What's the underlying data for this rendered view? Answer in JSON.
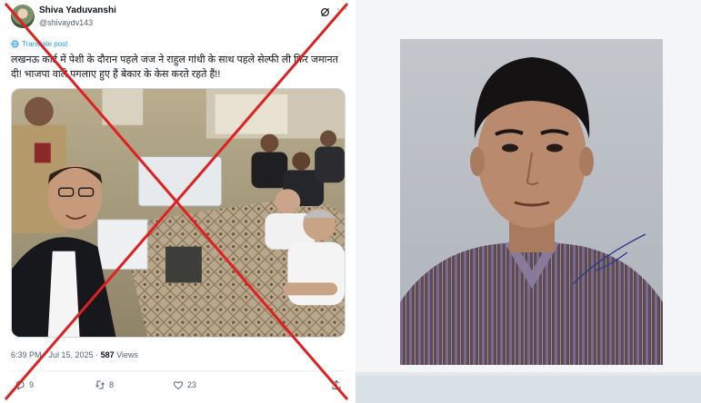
{
  "tweet": {
    "author_name": "Shiva Yaduvanshi",
    "author_handle": "@shivaydv143",
    "translate_label": "Translate post",
    "text": "लखनऊ कोर्ट में पेशी के दौरान पहले जज ने राहुल गांधी के साथ पहले सेल्फी ली फिर जमानत दी! भाजपा वाले पगलाए हुए हैं बेकार के केस करते रहते हैं!!",
    "time": "6:39 PM · Jul 15, 2025 · ",
    "views_count": "587",
    "views_label": " Views",
    "actions": {
      "replies": "9",
      "reposts": "8",
      "likes": "23"
    },
    "icons": [
      "grok-icon",
      "more-icon",
      "translate-icon",
      "reply-icon",
      "repost-icon",
      "like-icon",
      "share-icon"
    ]
  },
  "colors": {
    "link_blue": "#1d9bf0",
    "muted_text": "#536471",
    "fact_check_cross": "#e02020"
  }
}
